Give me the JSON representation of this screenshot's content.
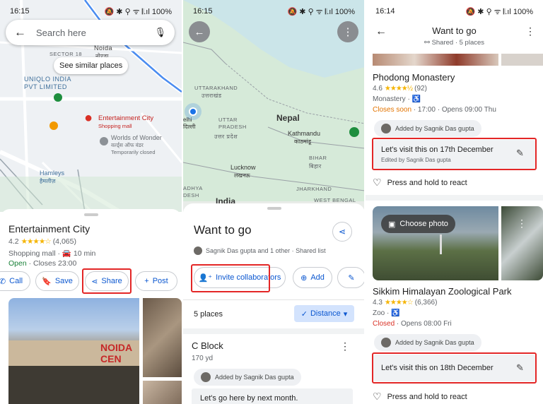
{
  "p1": {
    "time": "16:15",
    "status_icons": "🔕 ✱ ⚲ ᯤ 𝄃.ıl 100%",
    "search_placeholder": "Search here",
    "similar": "See similar places",
    "map": {
      "noida": "Noida",
      "noida_hi": "नोएडा",
      "sector": "SECTOR 18",
      "uniqlo": "UNIQLO INDIA\nPVT LIMITED",
      "ec": "Entertainment City",
      "ec_sub": "Shopping mall",
      "wow": "Worlds of Wonder",
      "wow_hi": "वर्ल्ड्स ऑफ वंडर",
      "wow_sub": "Temporarily closed",
      "hamleys": "Hamleys",
      "hamleys_hi": "हैमलीज़"
    },
    "name": "Entertainment City",
    "rating": "4.2",
    "stars": "★★★★☆",
    "reviews": "(4,065)",
    "type": "Shopping mall · ",
    "drive": "10 min",
    "open": "Open",
    "closes": " · Closes 23:00",
    "call": "Call",
    "save": "Save",
    "share": "Share",
    "post": "Post",
    "photo_sign": "NOIDA CEN"
  },
  "p2": {
    "time": "16:15",
    "status_icons": "🔕 ✱ ⚲ ᯤ 𝄃.ıl 100%",
    "map": {
      "uttarakhand": "UTTARAKHAND",
      "uttarakhand_hi": "उत्तराखंड",
      "up": "UTTAR\nPRADESH",
      "up_hi": "उत्तर प्रदेश",
      "nepal": "Nepal",
      "kathmandu": "Kathmandu",
      "kathmandu_hi": "काठमांडू",
      "lucknow": "Lucknow",
      "lucknow_hi": "लखनऊ",
      "bihar": "BIHAR",
      "bihar_hi": "बिहार",
      "jharkhand": "JHARKHAND",
      "wb": "WEST BENGAL",
      "india": "India",
      "delhi": "elhi\nदिल्ली",
      "adhya": "ADHYA\nDESH"
    },
    "title": "Want to go",
    "shared": "Sagnik Das gupta and 1 other · Shared list",
    "invite": "Invite collaborators",
    "add": "Add",
    "places": "5 places",
    "sort": "Distance",
    "item": "C Block",
    "dist": "170 yd",
    "added": "Added by Sagnik Das gupta",
    "note": "Let's go here by next month."
  },
  "p3": {
    "time": "16:14",
    "status_icons": "🔕 ✱ ⚲ ᯤ 𝄃.ıl 100%",
    "title": "Want to go",
    "sub": "Shared · 5 places",
    "place1": {
      "name": "Phodong Monastery",
      "rating": "4.6",
      "stars": "★★★★½",
      "reviews": "(92)",
      "type": "Monastery · ",
      "status": "Closes soon",
      "hours": " · 17:00 · Opens 09:00 Thu",
      "added": "Added by Sagnik Das gupta",
      "note": "Let's visit this on 17th December",
      "edited": "Edited by Sagnik Das gupta",
      "react": "Press and hold to react"
    },
    "choose": "Choose photo",
    "place2": {
      "name": "Sikkim Himalayan Zoological Park",
      "rating": "4.3",
      "stars": "★★★★☆",
      "reviews": "(6,366)",
      "type": "Zoo · ",
      "status": "Closed",
      "hours": " · Opens 08:00 Fri",
      "added": "Added by Sagnik Das gupta",
      "note": "Let's visit this on 18th December",
      "react": "Press and hold to react"
    }
  }
}
